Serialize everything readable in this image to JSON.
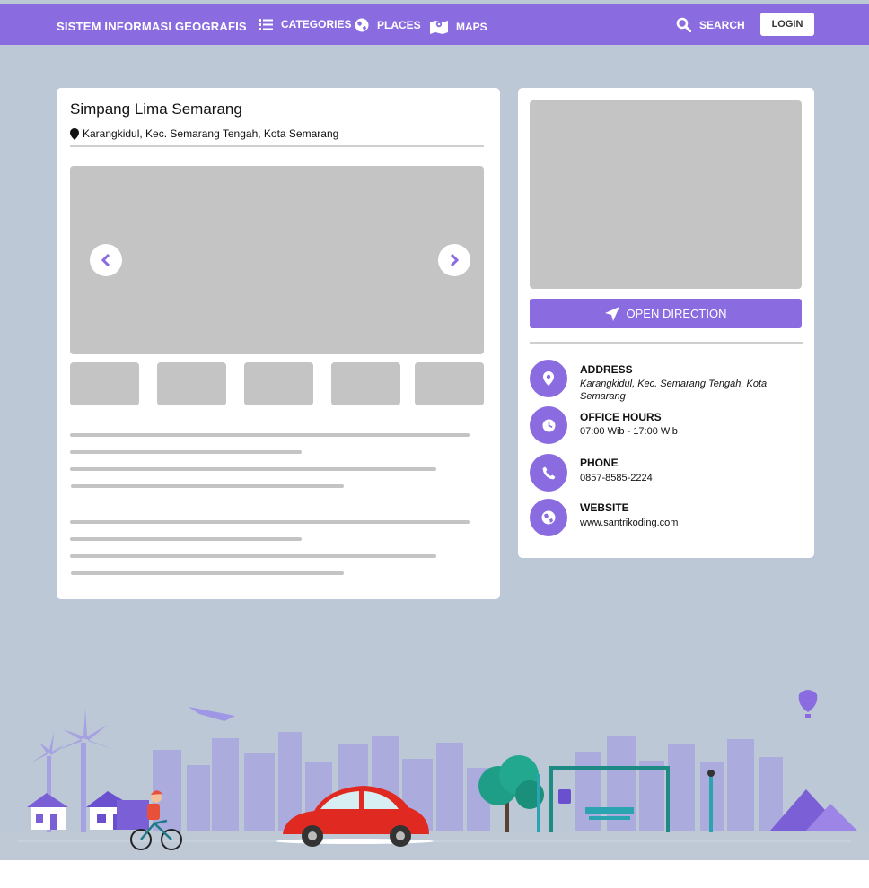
{
  "nav": {
    "brand": "SISTEM INFORMASI GEOGRAFIS",
    "items": [
      {
        "label": "CATEGORIES",
        "icon": "list-icon"
      },
      {
        "label": "PLACES",
        "icon": "globe-icon"
      },
      {
        "label": "MAPS",
        "icon": "map-icon"
      }
    ],
    "search_label": "SEARCH",
    "login_label": "LOGIN"
  },
  "place": {
    "title": "Simpang Lima Semarang",
    "address": "Karangkidul, Kec. Semarang Tengah, Kota Semarang"
  },
  "sidebar": {
    "direction_label": "OPEN DIRECTION",
    "info": [
      {
        "title": "ADDRESS",
        "value": "Karangkidul, Kec. Semarang Tengah, Kota Semarang",
        "icon": "location-pin-icon"
      },
      {
        "title": "OFFICE HOURS",
        "value": "07:00 Wib - 17:00 Wib",
        "icon": "clock-icon"
      },
      {
        "title": "PHONE",
        "value": "0857-8585-2224",
        "icon": "phone-icon"
      },
      {
        "title": "WEBSITE",
        "value": "www.santrikoding.com",
        "icon": "globe-icon"
      }
    ]
  },
  "colors": {
    "accent": "#8a6ce0",
    "background": "#bcc8d5",
    "placeholder": "#c4c4c4",
    "card": "#ffffff"
  }
}
